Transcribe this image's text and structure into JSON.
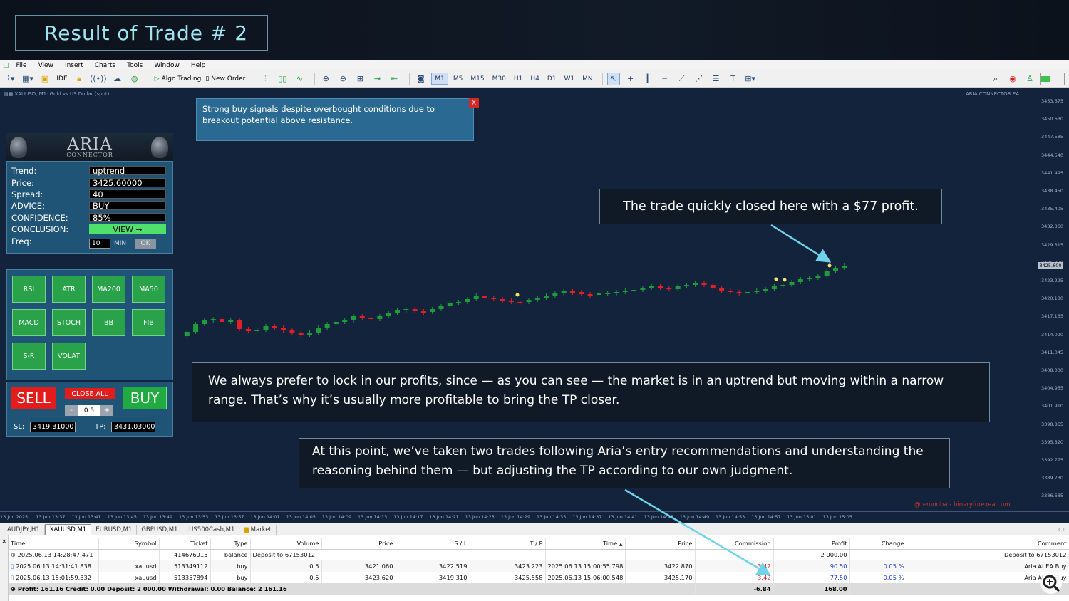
{
  "title": "Result of Trade # 2",
  "menu": [
    "File",
    "View",
    "Insert",
    "Charts",
    "Tools",
    "Window",
    "Help"
  ],
  "toolbar": {
    "ide": "IDE",
    "algo_trading": "Algo Trading",
    "new_order": "New Order",
    "timeframes": [
      "M1",
      "M5",
      "M15",
      "M30",
      "H1",
      "H4",
      "D1",
      "W1",
      "MN"
    ],
    "active_timeframe": "M1"
  },
  "chart": {
    "info": "XAUUSD, M1:  Gold vs US Dollar (spot)",
    "ea_label": "ARIA CONNECTOR EA",
    "current_price": "3425.600",
    "price_ticks": [
      "3453.675",
      "3450.630",
      "3447.585",
      "3444.540",
      "3441.495",
      "3438.450",
      "3435.405",
      "3432.360",
      "3429.315",
      "3426.270",
      "3423.225",
      "3420.180",
      "3417.135",
      "3414.090",
      "3411.045",
      "3408.000",
      "3404.955",
      "3401.910",
      "3398.865",
      "3395.820",
      "3392.775",
      "3389.730",
      "3386.685"
    ],
    "time_ticks": [
      "13 Jun 2025",
      "13 Jun 13:37",
      "13 Jun 13:41",
      "13 Jun 13:45",
      "13 Jun 13:49",
      "13 Jun 13:53",
      "13 Jun 13:57",
      "13 Jun 14:01",
      "13 Jun 14:05",
      "13 Jun 14:09",
      "13 Jun 14:13",
      "13 Jun 14:17",
      "13 Jun 14:21",
      "13 Jun 14:25",
      "13 Jun 14:29",
      "13 Jun 14:33",
      "13 Jun 14:37",
      "13 Jun 14:41",
      "13 Jun 14:45",
      "13 Jun 14:49",
      "13 Jun 14:53",
      "13 Jun 14:57",
      "13 Jun 15:01",
      "13 Jun 15:05"
    ],
    "watermark": "@temonba - binaryforexea.com",
    "colors": {
      "bull": "#1e9c3a",
      "bear": "#e01f26",
      "background": "#13233c",
      "arrow": "#6fd3ea"
    }
  },
  "insight": {
    "text": "Strong buy signals despite overbought conditions due to breakout potential above resistance.",
    "close": "X"
  },
  "aria": {
    "name": "ARIA",
    "subtitle": "CONNECTOR",
    "rows": [
      {
        "label": "Trend:",
        "value": "uptrend"
      },
      {
        "label": "Price:",
        "value": "3425.60000"
      },
      {
        "label": "Spread:",
        "value": "40"
      },
      {
        "label": "ADVICE:",
        "value": " BUY"
      },
      {
        "label": "CONFIDENCE:",
        "value": " 85%"
      }
    ],
    "conclusion_label": "CONCLUSION:",
    "view_label": "VIEW →",
    "freq_label": "Freq:",
    "freq_value": "10",
    "freq_unit": "MIN",
    "ok_label": "OK"
  },
  "indicators": [
    "RSI",
    "ATR",
    "MA200",
    "MA50",
    "MACD",
    "STOCH",
    "BB",
    "FIB",
    "S-R",
    "VOLAT"
  ],
  "trade": {
    "sell": "SELL",
    "buy": "BUY",
    "close_all": "CLOSE ALL",
    "minus": "-",
    "plus": "+",
    "lot": "0.5",
    "sl_label": "SL:",
    "sl_value": "3419.31000",
    "tp_label": "TP:",
    "tp_value": "3431.03000"
  },
  "annotations": {
    "profit": "The trade quickly closed here with a $77 profit.",
    "lock": "We always prefer to lock in our profits, since — as you can see — the market is in an uptrend but moving within a narrow range. That’s why it’s usually more profitable to bring the TP closer.",
    "trades": "At this point, we’ve taken two trades following Aria’s entry recommendations and understanding the reasoning behind them — but adjusting the TP according to our own judgment."
  },
  "symbol_tabs": [
    "AUDJPY,H1",
    "XAUUSD,M1",
    "EURUSD,M1",
    "GBPUSD,M1",
    ".US500Cash,M1",
    "Market"
  ],
  "active_tab": "XAUUSD,M1",
  "history": {
    "headers": [
      "Time",
      "Symbol",
      "Ticket",
      "Type",
      "Volume",
      "Price",
      "S / L",
      "T / P",
      "Time",
      "Price",
      "Commission",
      "Profit",
      "Change",
      "Comment"
    ],
    "rows": [
      [
        "2025.06.13 14:28:47.471",
        "",
        "414676915",
        "balance",
        "Deposit to 67153012",
        "",
        "",
        "",
        "",
        "",
        "",
        "2 000.00",
        "",
        "Deposit to 67153012"
      ],
      [
        "2025.06.13 14:31:41.838",
        "xauusd",
        "513349112",
        "buy",
        "0.5",
        "3421.060",
        "3422.519",
        "3423.223",
        "2025.06.13 15:00:55.798",
        "3422.870",
        "-3.42",
        "90.50",
        "0.05 %",
        "Aria AI EA Buy"
      ],
      [
        "2025.06.13 15:01:59.332",
        "xauusd",
        "513357894",
        "buy",
        "0.5",
        "3423.620",
        "3419.310",
        "3425.558",
        "2025.06.13 15:06:00.548",
        "3425.170",
        "-3.42",
        "77.50",
        "0.05 %",
        "Aria AI EA Buy"
      ]
    ],
    "summary": "Profit: 161.16  Credit: 0.00  Deposit: 2 000.00  Withdrawal: 0.00  Balance: 2 161.16",
    "summary_commission": "-6.84",
    "summary_profit": "168.00"
  }
}
